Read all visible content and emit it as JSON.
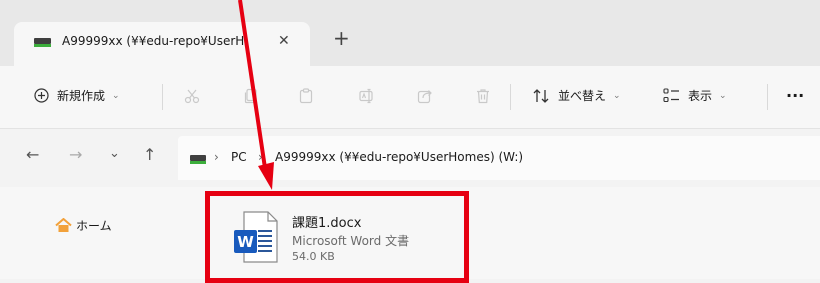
{
  "tab": {
    "title": "A99999xx (¥¥edu-repo¥UserH",
    "close_glyph": "✕",
    "new_tab_glyph": "+"
  },
  "toolbar": {
    "new_label": "新規作成",
    "sort_label": "並べ替え",
    "view_label": "表示",
    "more_glyph": "···",
    "chevron": "⌄",
    "icons": [
      "plus-circle-icon",
      "cut-icon",
      "copy-icon",
      "paste-icon",
      "rename-icon",
      "share-icon",
      "delete-icon",
      "sort-icon",
      "view-icon",
      "more-icon"
    ]
  },
  "address": {
    "separator": "›",
    "segments": [
      "PC",
      "A99999xx (¥¥edu-repo¥UserHomes) (W:)"
    ],
    "nav_glyphs": {
      "back": "←",
      "forward": "→",
      "recent": "⌄",
      "up": "↑"
    }
  },
  "navigation_pane": {
    "home_label": "ホーム"
  },
  "file": {
    "name": "課題1.docx",
    "type": "Microsoft Word 文書",
    "size": "54.0 KB",
    "icon_letter": "W"
  },
  "colors": {
    "annotation_red": "#e60012",
    "word_blue": "#185abd",
    "home_orange": "#f2a13a"
  }
}
